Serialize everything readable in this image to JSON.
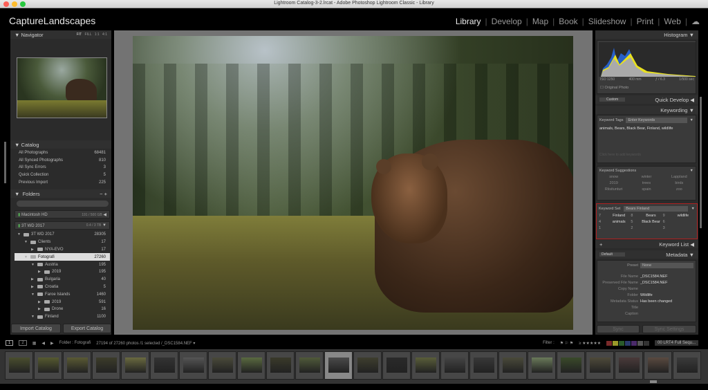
{
  "window": {
    "title": "Lightroom Catalog-3-2.lrcat - Adobe Photoshop Lightroom Classic - Library"
  },
  "brand": "CaptureLandscapes",
  "modules": [
    "Library",
    "Develop",
    "Map",
    "Book",
    "Slideshow",
    "Print",
    "Web"
  ],
  "active_module": "Library",
  "navigator": {
    "title": "Navigator",
    "zoom": [
      "FIT",
      "FILL",
      "1:1",
      "4:1"
    ]
  },
  "catalog": {
    "title": "Catalog",
    "items": [
      {
        "label": "All Photographs",
        "count": "68481"
      },
      {
        "label": "All Synced Photographs",
        "count": "810"
      },
      {
        "label": "All Sync Errors",
        "count": "3"
      },
      {
        "label": "Quick Collection",
        "count": "5"
      },
      {
        "label": "Previous Import",
        "count": "225"
      }
    ]
  },
  "folders": {
    "title": "Folders",
    "volumes": [
      {
        "label": "Macintosh HD",
        "size": "191 / 500 GB"
      },
      {
        "label": "3T WD 2017",
        "size": "0.4 / 3 TB"
      }
    ],
    "tree": [
      {
        "label": "3T WD 2017",
        "count": "28305",
        "depth": 0,
        "open": true
      },
      {
        "label": "Clients",
        "count": "17",
        "depth": 1,
        "open": true
      },
      {
        "label": "NYA-EVO",
        "count": "17",
        "depth": 2,
        "open": false
      },
      {
        "label": "Fotografi",
        "count": "27260",
        "depth": 1,
        "open": true,
        "selected": true
      },
      {
        "label": "Austria",
        "count": "195",
        "depth": 2,
        "open": true
      },
      {
        "label": "2019",
        "count": "195",
        "depth": 3,
        "open": false
      },
      {
        "label": "Bulgaria",
        "count": "40",
        "depth": 2,
        "open": false
      },
      {
        "label": "Croatia",
        "count": "5",
        "depth": 2,
        "open": false
      },
      {
        "label": "Faroe Islands",
        "count": "1460",
        "depth": 2,
        "open": true
      },
      {
        "label": "2019",
        "count": "591",
        "depth": 3,
        "open": false
      },
      {
        "label": "Drone",
        "count": "16",
        "depth": 3,
        "open": false
      },
      {
        "label": "Finland",
        "count": "1100",
        "depth": 2,
        "open": true
      }
    ]
  },
  "left_buttons": {
    "import": "Import Catalog",
    "export": "Export Catalog"
  },
  "histogram": {
    "title": "Histogram",
    "iso": "ISO 1250",
    "focal": "400 mm",
    "aperture": "ƒ / 6.3",
    "shutter": "1/500 sec",
    "original_photo": "Original Photo"
  },
  "quick_develop": {
    "title": "Quick Develop",
    "preset": "Custom"
  },
  "keywording": {
    "title": "Keywording",
    "tags_label": "Keyword Tags",
    "tags_mode": "Enter Keywords",
    "keywords": "animals, Bears, Black Bear, Finland, wildlife",
    "placeholder": "Click here to add keywords",
    "suggestions_title": "Keyword Suggestions",
    "suggestions": [
      "snow",
      "winter",
      "Lappland",
      "2019",
      "trees",
      "birds",
      "Riisitunturi",
      "spain",
      "zoo"
    ],
    "set_label": "Keyword Set",
    "set_value": "Bears Finland",
    "set_items": [
      {
        "n": "7",
        "k": "Finland"
      },
      {
        "n": "8",
        "k": "Bears"
      },
      {
        "n": "9",
        "k": "wildlife"
      },
      {
        "n": "4",
        "k": "animals"
      },
      {
        "n": "5",
        "k": "Black Bear"
      },
      {
        "n": "6",
        "k": ""
      },
      {
        "n": "1",
        "k": ""
      },
      {
        "n": "2",
        "k": ""
      },
      {
        "n": "3",
        "k": ""
      }
    ]
  },
  "keyword_list": {
    "title": "Keyword List"
  },
  "metadata": {
    "title": "Metadata",
    "preset_select": "Default",
    "preset_label": "Preset",
    "preset_value": "None",
    "fields": [
      {
        "label": "File Name",
        "value": "_DSC1584.NEF"
      },
      {
        "label": "Preserved File Name",
        "value": "_DSC1584.NEF"
      },
      {
        "label": "Copy Name",
        "value": ""
      },
      {
        "label": "Folder",
        "value": "Wildlife"
      },
      {
        "label": "Metadata Status",
        "value": "Has been changed"
      },
      {
        "label": "Title",
        "value": ""
      },
      {
        "label": "Caption",
        "value": ""
      }
    ]
  },
  "sync": {
    "sync": "Sync",
    "sync_settings": "Sync Settings"
  },
  "toolbar": {
    "view1": "1",
    "view2": "2",
    "folder": "Folder : Fotografi",
    "status": "27194 of 27260 photos /1 selected /_DSC1584.NEF",
    "filter_label": "Filter :",
    "rating_op": "≥",
    "filter_preset": "00 LRT4 Full Sequ..."
  },
  "colors": {
    "accent_red": "#b02020",
    "label_colors": [
      "#7a2a2a",
      "#9a9a2a",
      "#2a5a2a",
      "#2a3a6a",
      "#4a2a6a",
      "#555",
      "#333"
    ]
  }
}
